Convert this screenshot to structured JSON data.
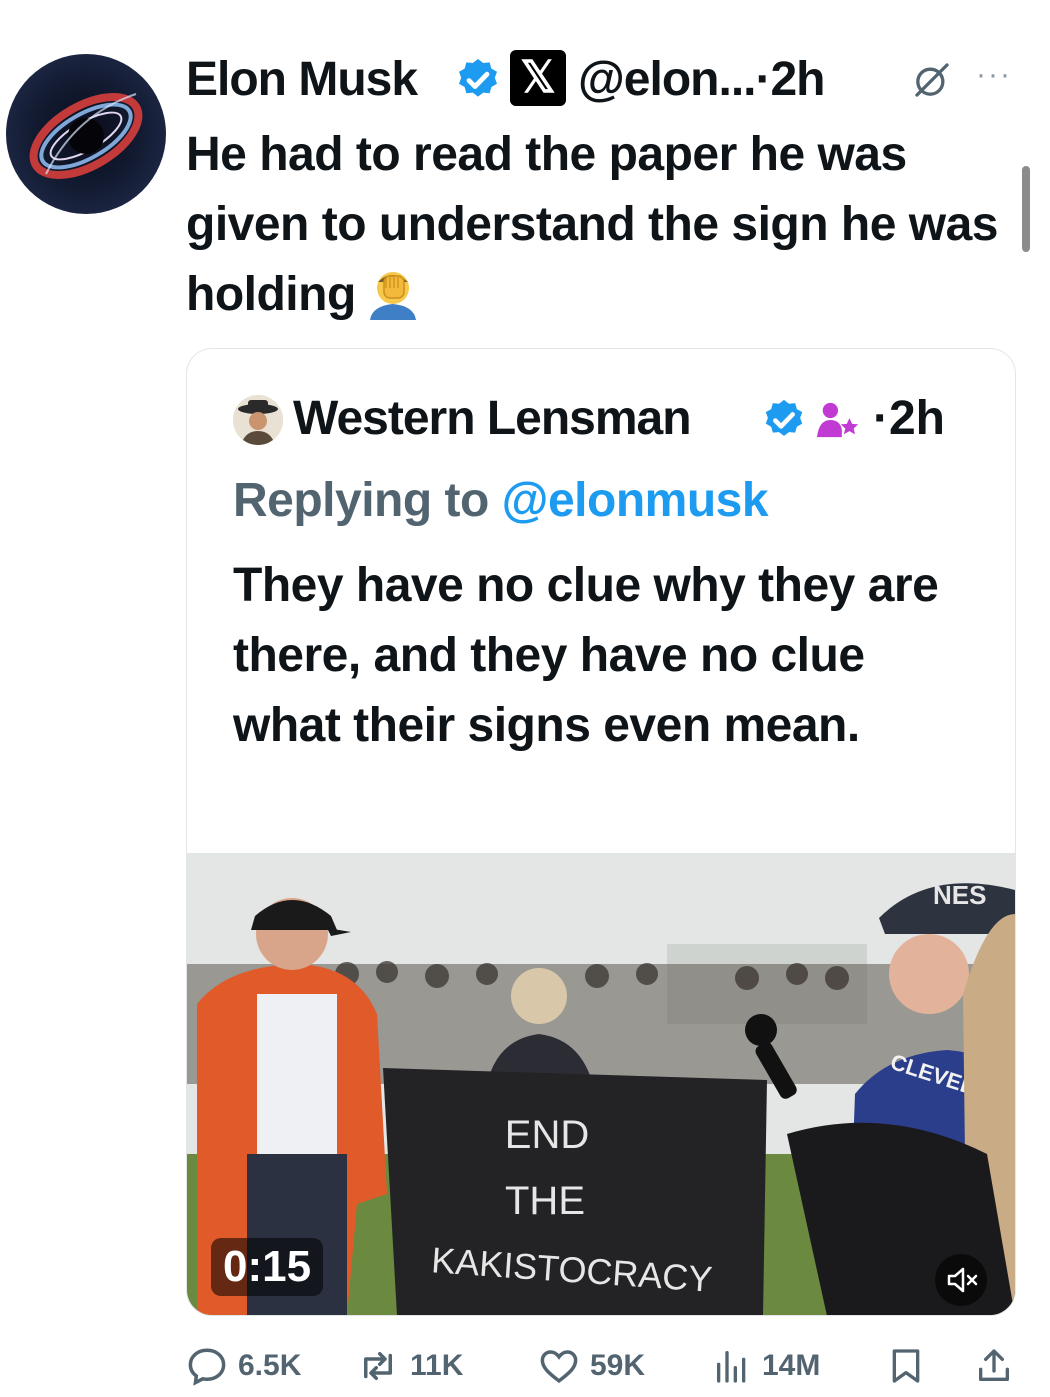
{
  "post": {
    "author_name": "Elon Musk",
    "handle": "@elon...",
    "separator": "·",
    "time": "2h",
    "more": "···",
    "text": "He had to read the paper he was given to understand the sign he was holding",
    "emoji": "facepalm"
  },
  "quoted": {
    "author_name": "Western Lensman",
    "separator": "·",
    "time": "2h",
    "replying_prefix": "Replying to",
    "replying_handle": "@elonmusk",
    "text": "They have no clue why they are there, and they have no clue what their signs even mean.",
    "video": {
      "duration": "0:15",
      "banner_lines": [
        "END",
        "THE",
        "KAKISTOCRACY"
      ],
      "shirt_text": "CLEVELAND",
      "hat_text": "NES"
    }
  },
  "actions": {
    "replies": "6.5K",
    "reposts": "11K",
    "likes": "59K",
    "views": "14M"
  },
  "colors": {
    "verified": "#1d9bf0",
    "mention": "#1d9bf0",
    "muted_text": "#536471",
    "affiliate": "#c13ad3"
  },
  "icons": [
    "grok-icon",
    "more-icon",
    "verified-icon",
    "x-logo-icon",
    "affiliate-icon",
    "mute-icon",
    "reply-icon",
    "repost-icon",
    "like-icon",
    "views-icon",
    "bookmark-icon",
    "share-icon"
  ]
}
